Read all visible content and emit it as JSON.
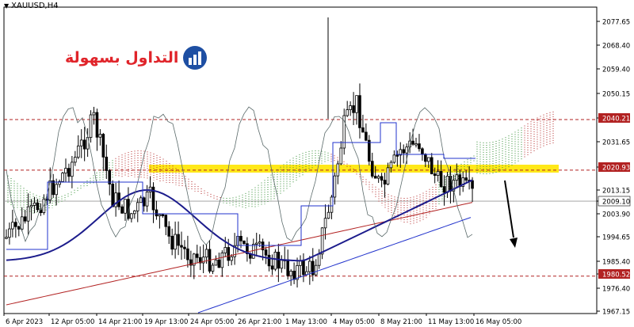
{
  "header": {
    "symbol": "XAUUSD,H4"
  },
  "logo": {
    "text": "التداول بسهولة"
  },
  "price_axis": {
    "ticks": [
      "2077.65",
      "2068.40",
      "2059.40",
      "2050.15",
      "2040.21",
      "2031.65",
      "2020.93",
      "2013.15",
      "2009.10",
      "2003.90",
      "1994.65",
      "1985.40",
      "1980.52",
      "1976.40",
      "1967.15"
    ],
    "current_price": "2009.10"
  },
  "levels": [
    {
      "label": "2040.21",
      "price": 2040.21,
      "color": "#b22222"
    },
    {
      "label": "2020.93",
      "price": 2020.93,
      "color": "#b22222"
    },
    {
      "label": "1980.52",
      "price": 1980.52,
      "color": "#b22222"
    }
  ],
  "time_axis": {
    "labels": [
      "6 Apr 2023",
      "12 Apr 05:00",
      "14 Apr 21:00",
      "19 Apr 13:00",
      "24 Apr 05:00",
      "26 Apr 21:00",
      "1 May 13:00",
      "4 May 05:00",
      "8 May 21:00",
      "11 May 13:00",
      "16 May 05:00"
    ]
  },
  "colors": {
    "candles": "#000000",
    "level": "#b22222",
    "highlight": "#ffe600",
    "ma_fast": "#1c1c8c",
    "ma_slow": "#b22222",
    "lagging": "#5a6a6a",
    "cloud_bull": "#2e8b2e",
    "cloud_bear": "#b22222"
  }
}
